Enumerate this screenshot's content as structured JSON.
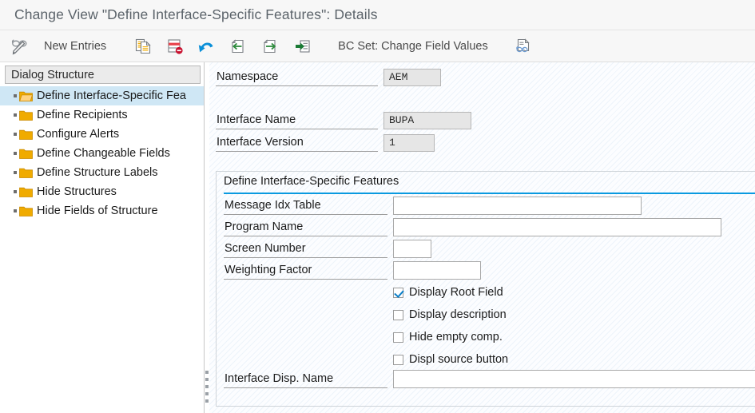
{
  "window": {
    "title": "Change View \"Define Interface-Specific Features\": Details"
  },
  "toolbar": {
    "display_change_icon": "glasses-pencil-icon",
    "new_entries_label": "New Entries",
    "copy_icon": "copy-as-icon",
    "delete_icon": "delete-row-icon",
    "undo_icon": "undo-icon",
    "previous_icon": "previous-entry-icon",
    "next_icon": "next-entry-icon",
    "goto_icon": "goto-entry-icon",
    "bc_set_label": "BC Set: Change Field Values",
    "bc_set_display_icon": "display-bc-set-icon"
  },
  "tree": {
    "header": "Dialog Structure",
    "items": [
      {
        "label": "Define Interface-Specific Fea",
        "icon": "folder-open-icon",
        "selected": true
      },
      {
        "label": "Define Recipients",
        "icon": "folder-icon",
        "selected": false
      },
      {
        "label": "Configure Alerts",
        "icon": "folder-icon",
        "selected": false
      },
      {
        "label": "Define Changeable Fields",
        "icon": "folder-icon",
        "selected": false
      },
      {
        "label": "Define Structure Labels",
        "icon": "folder-icon",
        "selected": false
      },
      {
        "label": "Hide Structures",
        "icon": "folder-icon",
        "selected": false
      },
      {
        "label": "Hide Fields of Structure",
        "icon": "folder-icon",
        "selected": false
      }
    ]
  },
  "details": {
    "key_fields": [
      {
        "label": "Namespace",
        "value": "AEM"
      },
      {
        "label": "Interface Name",
        "value": "BUPA"
      },
      {
        "label": "Interface Version",
        "value": "1"
      }
    ],
    "group": {
      "title": "Define Interface-Specific Features",
      "fields": [
        {
          "label": "Message Idx Table",
          "value": "",
          "placeholder": ""
        },
        {
          "label": "Program Name",
          "value": "",
          "placeholder": ""
        },
        {
          "label": "Screen Number",
          "value": "",
          "placeholder": ""
        },
        {
          "label": "Weighting Factor",
          "value": "",
          "placeholder": ""
        }
      ],
      "checkboxes": [
        {
          "label": "Display Root Field",
          "checked": true
        },
        {
          "label": "Display description",
          "checked": false
        },
        {
          "label": "Hide empty comp.",
          "checked": false
        },
        {
          "label": "Displ source button",
          "checked": false
        }
      ],
      "bottom_field": {
        "label": "Interface Disp. Name",
        "value": "",
        "placeholder": ""
      }
    }
  },
  "colors": {
    "accent_blue": "#0a9ae0",
    "folder_yellow": "#f0ab00",
    "selection_blue": "#cfe7f5",
    "title_gray": "#5b636a"
  }
}
